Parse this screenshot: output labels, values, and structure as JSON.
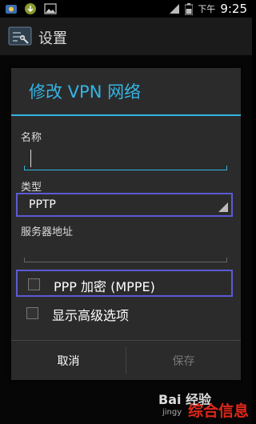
{
  "status_bar": {
    "ampm": "下午",
    "time": "9:25"
  },
  "action_bar": {
    "title": "设置"
  },
  "dialog": {
    "title": "修改 VPN 网络",
    "name_label": "名称",
    "name_value": "",
    "type_label": "类型",
    "type_value": "PPTP",
    "server_label": "服务器地址",
    "server_value": "",
    "ppp_encryption_label": "PPP 加密 (MPPE)",
    "ppp_encryption_checked": false,
    "show_advanced_label": "显示高级选项",
    "show_advanced_checked": false,
    "cancel_label": "取消",
    "save_label": "保存"
  },
  "colors": {
    "accent": "#34b5e5",
    "highlight": "#5b5bd6",
    "watermark_red": "#e0261a"
  },
  "watermark": {
    "logo_text": "Bai 经验",
    "url": "jingy",
    "site_name": "综合信息"
  }
}
